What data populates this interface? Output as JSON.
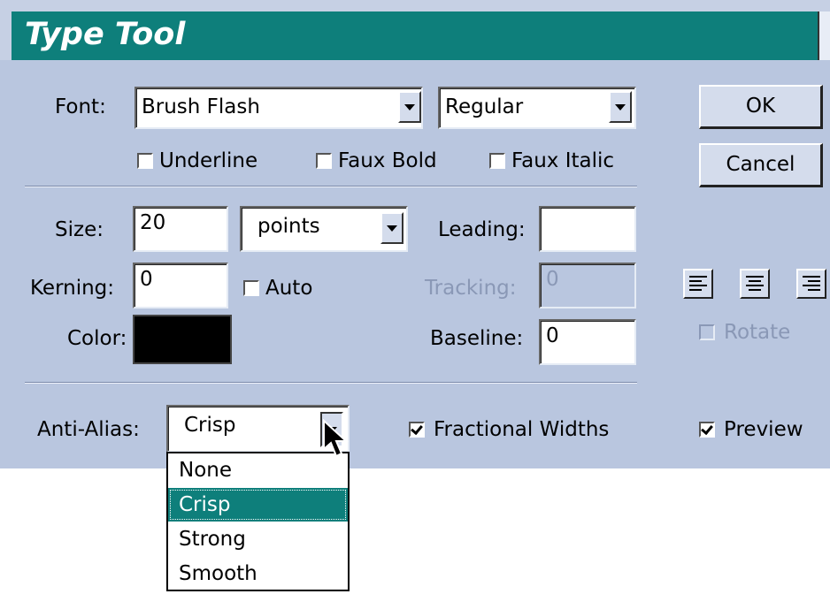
{
  "window": {
    "title": "Type Tool"
  },
  "font": {
    "label": "Font:",
    "family_value": "Brush Flash",
    "style_value": "Regular",
    "underline_label": "Underline",
    "faux_bold_label": "Faux Bold",
    "faux_italic_label": "Faux Italic",
    "underline_checked": false,
    "faux_bold_checked": false,
    "faux_italic_checked": false
  },
  "buttons": {
    "ok_label": "OK",
    "cancel_label": "Cancel"
  },
  "size": {
    "label": "Size:",
    "value": "20",
    "unit_value": "points"
  },
  "leading": {
    "label": "Leading:",
    "value": ""
  },
  "kerning": {
    "label": "Kerning:",
    "value": "0",
    "auto_label": "Auto",
    "auto_checked": false
  },
  "tracking": {
    "label": "Tracking:",
    "value": "0",
    "disabled": true
  },
  "color": {
    "label": "Color:",
    "swatch": "#000000"
  },
  "baseline": {
    "label": "Baseline:",
    "value": "0"
  },
  "alignment": {
    "options": [
      "align-left",
      "align-center",
      "align-right"
    ]
  },
  "rotate": {
    "label": "Rotate",
    "checked": false,
    "disabled": true
  },
  "anti_alias": {
    "label": "Anti-Alias:",
    "value": "Crisp",
    "options": [
      "None",
      "Crisp",
      "Strong",
      "Smooth"
    ],
    "selected_index": 1
  },
  "fractional_widths": {
    "label": "Fractional Widths",
    "checked": true
  },
  "preview": {
    "label": "Preview",
    "checked": true
  },
  "colors": {
    "titlebar": "#0e7f7b",
    "dialog": "#b9c6df",
    "selection": "#0e7f7b"
  }
}
